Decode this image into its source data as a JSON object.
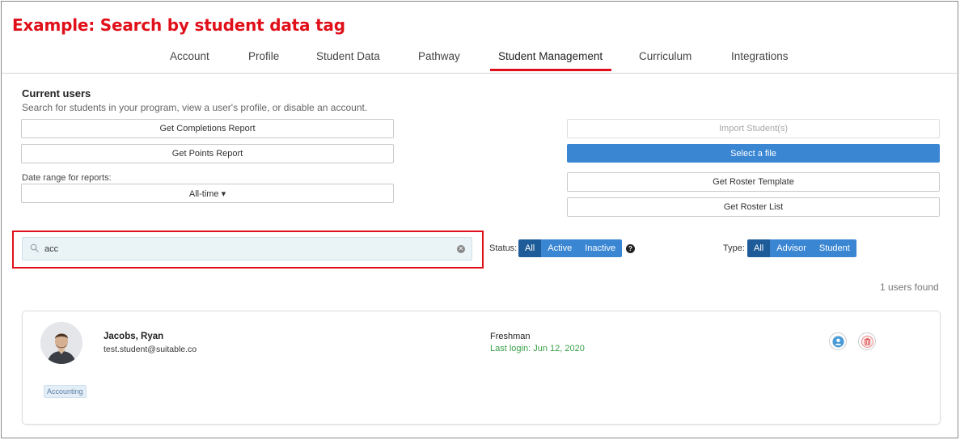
{
  "banner": "Example: Search by student data tag",
  "tabs": [
    {
      "label": "Account"
    },
    {
      "label": "Profile"
    },
    {
      "label": "Student Data"
    },
    {
      "label": "Pathway"
    },
    {
      "label": "Student Management"
    },
    {
      "label": "Curriculum"
    },
    {
      "label": "Integrations"
    }
  ],
  "active_tab": "Student Management",
  "colors": {
    "accent": "#e0101a",
    "primary": "#3a86d3",
    "primary_dark": "#1e5c99",
    "success": "#3aa14a"
  },
  "current_users": {
    "title": "Current users",
    "description": "Search for students in your program, view a user's profile, or disable an account.",
    "buttons": {
      "completions_report": "Get Completions Report",
      "points_report": "Get Points Report",
      "import_students": "Import Student(s)",
      "select_file": "Select a file",
      "roster_template": "Get Roster Template",
      "roster_list": "Get Roster List"
    },
    "date_range_label": "Date range for reports:",
    "date_range_value": "All-time ▾"
  },
  "search": {
    "value": "acc",
    "icon": "search-icon",
    "clear_icon": "clear-icon"
  },
  "status_filter": {
    "label": "Status:",
    "options": [
      "All",
      "Active",
      "Inactive"
    ],
    "selected": "All",
    "help_icon": "help-icon"
  },
  "type_filter": {
    "label": "Type:",
    "options": [
      "All",
      "Advisor",
      "Student"
    ],
    "selected": "All"
  },
  "results_count": "1 users found",
  "users": [
    {
      "name": "Jacobs, Ryan",
      "email": "test.student@suitable.co",
      "grade": "Freshman",
      "last_login": "Last login: Jun 12, 2020",
      "tag": "Accounting",
      "actions": [
        "profile-icon",
        "trash-icon"
      ]
    }
  ]
}
